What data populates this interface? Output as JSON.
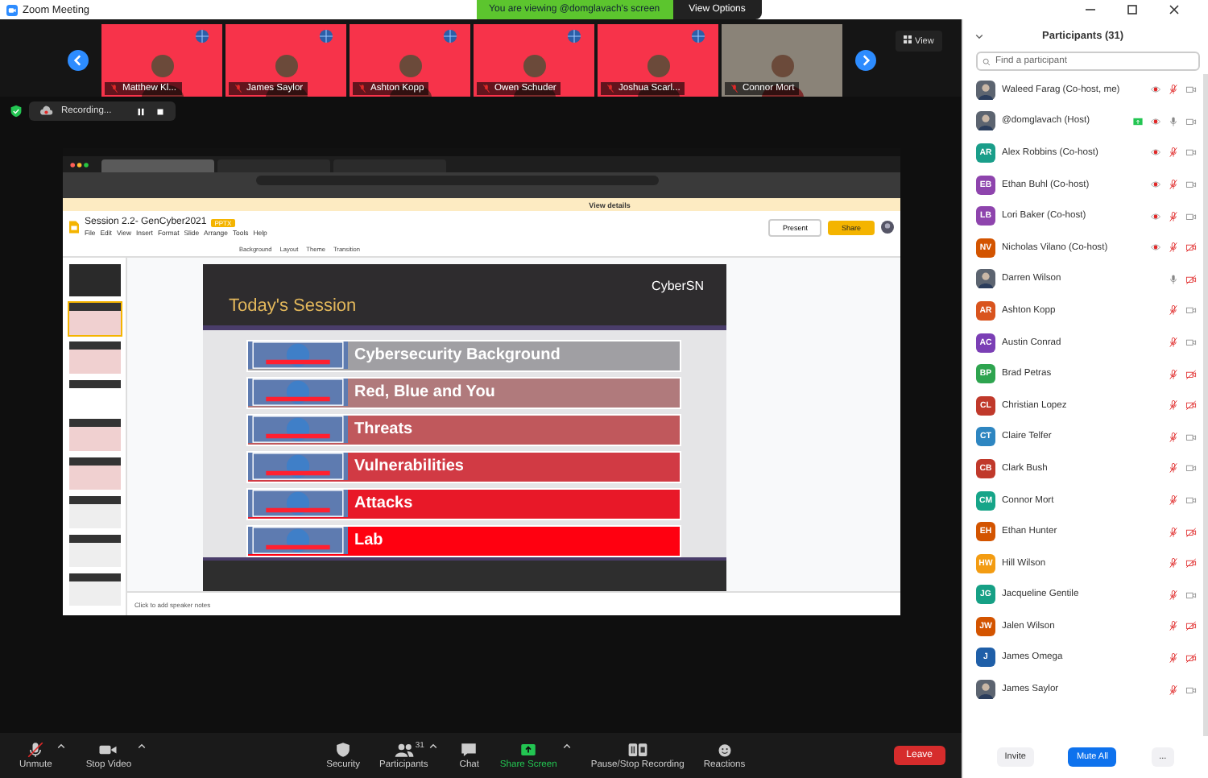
{
  "window": {
    "title": "Zoom Meeting"
  },
  "viewing_banner": {
    "text": "You are viewing @domglavach's screen",
    "options": "View Options"
  },
  "video_strip": {
    "view_label": "View",
    "tiles": [
      {
        "name": "Matthew Kl...",
        "kind": "branded",
        "muted": true
      },
      {
        "name": "James Saylor",
        "kind": "branded",
        "muted": true
      },
      {
        "name": "Ashton Kopp",
        "kind": "branded",
        "muted": true
      },
      {
        "name": "Owen Schuder",
        "kind": "branded",
        "muted": true
      },
      {
        "name": "Joshua Scarl...",
        "kind": "branded",
        "muted": true
      },
      {
        "name": "Connor Mort",
        "kind": "camera",
        "muted": true
      }
    ]
  },
  "recording": {
    "label": "Recording..."
  },
  "shared_screen": {
    "browser_tabs": [
      {
        "selected": true
      },
      {
        "selected": false
      },
      {
        "selected": false
      }
    ],
    "banner_link": "View details",
    "doc_title": "Session 2.2- GenCyber2021",
    "doc_badge": "PPTX",
    "menu": [
      "File",
      "Edit",
      "View",
      "Insert",
      "Format",
      "Slide",
      "Arrange",
      "Tools",
      "Help"
    ],
    "present": "Present",
    "share": "Share",
    "toolbar": [
      "Background",
      "Layout",
      "Theme",
      "Transition"
    ],
    "thumbnails": [
      {
        "kind": "dark",
        "selected": false
      },
      {
        "kind": "list",
        "selected": true
      },
      {
        "kind": "list",
        "selected": false
      },
      {
        "kind": "photo",
        "selected": false
      },
      {
        "kind": "list",
        "selected": false
      },
      {
        "kind": "list",
        "selected": false
      },
      {
        "kind": "grid",
        "selected": false
      },
      {
        "kind": "grid",
        "selected": false
      },
      {
        "kind": "grid",
        "selected": false
      }
    ],
    "slide": {
      "title": "Today's Session",
      "brand": "CyberSN",
      "items": [
        {
          "label": "Cybersecurity Background",
          "color": "#a09fa3"
        },
        {
          "label": "Red, Blue and You",
          "color": "#b07a7c"
        },
        {
          "label": "Threats",
          "color": "#c0585c"
        },
        {
          "label": "Vulnerabilities",
          "color": "#d13a44"
        },
        {
          "label": "Attacks",
          "color": "#e81828"
        },
        {
          "label": "Lab",
          "color": "#ff0010"
        }
      ]
    },
    "notes": "Click to add speaker notes"
  },
  "toolbar": [
    {
      "kind": "mic",
      "label": "Unmute",
      "caret": true
    },
    {
      "kind": "video",
      "label": "Stop Video",
      "caret": true
    },
    {
      "kind": "security",
      "label": "Security",
      "caret": false
    },
    {
      "kind": "participants",
      "label": "Participants",
      "count": "31",
      "caret": true
    },
    {
      "kind": "chat",
      "label": "Chat",
      "caret": false
    },
    {
      "kind": "share",
      "label": "Share Screen",
      "caret": true
    },
    {
      "kind": "record",
      "label": "Pause/Stop Recording",
      "caret": false
    },
    {
      "kind": "reactions",
      "label": "Reactions",
      "caret": false
    }
  ],
  "leave_button": "Leave",
  "participants": {
    "title": "Participants (31)",
    "search": {
      "placeholder": "Find a participant"
    },
    "items": [
      {
        "name": "Waleed Farag (Co-host, me)",
        "kind": "photo",
        "sharing": false,
        "recording": true,
        "muted": true,
        "video_off": false
      },
      {
        "name": "@domglavach (Host)",
        "kind": "photo",
        "sharing": true,
        "recording": true,
        "muted": false,
        "video_off": false
      },
      {
        "name": "Alex Robbins (Co-host)",
        "kind": "initials",
        "initials": "AR",
        "color": "#1a9e8a",
        "sharing": false,
        "recording": true,
        "muted": true,
        "video_off": false
      },
      {
        "name": "Ethan Buhl (Co-host)",
        "kind": "initials",
        "initials": "EB",
        "color": "#8e44ad",
        "sharing": false,
        "recording": true,
        "muted": true,
        "video_off": false
      },
      {
        "name": "Lori Baker (Co-host)",
        "kind": "initials",
        "initials": "LB",
        "color": "#8e44ad",
        "sharing": false,
        "recording": true,
        "muted": true,
        "video_off": false
      },
      {
        "name": "Nicholas Vilano (Co-host)",
        "kind": "initials",
        "initials": "NV",
        "color": "#d35400",
        "sharing": false,
        "recording": true,
        "muted": true,
        "video_off": true
      },
      {
        "name": "Darren Wilson",
        "kind": "photo",
        "sharing": false,
        "recording": false,
        "muted": false,
        "video_off": true
      },
      {
        "name": "Ashton Kopp",
        "kind": "initials",
        "initials": "AR",
        "color": "#d9541e",
        "sharing": false,
        "recording": false,
        "muted": true,
        "video_off": false
      },
      {
        "name": "Austin Conrad",
        "kind": "initials",
        "initials": "AC",
        "color": "#7b3fb5",
        "sharing": false,
        "recording": false,
        "muted": true,
        "video_off": false
      },
      {
        "name": "Brad Petras",
        "kind": "initials",
        "initials": "BP",
        "color": "#2ea44f",
        "sharing": false,
        "recording": false,
        "muted": true,
        "video_off": true
      },
      {
        "name": "Christian Lopez",
        "kind": "initials",
        "initials": "CL",
        "color": "#c0392b",
        "sharing": false,
        "recording": false,
        "muted": true,
        "video_off": true
      },
      {
        "name": "Claire Telfer",
        "kind": "initials",
        "initials": "CT",
        "color": "#2e86c1",
        "sharing": false,
        "recording": false,
        "muted": true,
        "video_off": false
      },
      {
        "name": "Clark Bush",
        "kind": "initials",
        "initials": "CB",
        "color": "#c0392b",
        "sharing": false,
        "recording": false,
        "muted": true,
        "video_off": false
      },
      {
        "name": "Connor Mort",
        "kind": "initials",
        "initials": "CM",
        "color": "#17a589",
        "sharing": false,
        "recording": false,
        "muted": true,
        "video_off": false
      },
      {
        "name": "Ethan Hunter",
        "kind": "initials",
        "initials": "EH",
        "color": "#d35400",
        "sharing": false,
        "recording": false,
        "muted": true,
        "video_off": true
      },
      {
        "name": "Hill Wilson",
        "kind": "initials",
        "initials": "HW",
        "color": "#f39c12",
        "sharing": false,
        "recording": false,
        "muted": true,
        "video_off": true
      },
      {
        "name": "Jacqueline Gentile",
        "kind": "initials",
        "initials": "JG",
        "color": "#16a085",
        "sharing": false,
        "recording": false,
        "muted": true,
        "video_off": false
      },
      {
        "name": "Jalen Wilson",
        "kind": "initials",
        "initials": "JW",
        "color": "#d35400",
        "sharing": false,
        "recording": false,
        "muted": true,
        "video_off": true
      },
      {
        "name": "James Omega",
        "kind": "initials",
        "initials": "J",
        "color": "#1f5fa8",
        "sharing": false,
        "recording": false,
        "muted": true,
        "video_off": true
      },
      {
        "name": "James Saylor",
        "kind": "photo",
        "sharing": false,
        "recording": false,
        "muted": true,
        "video_off": false
      }
    ],
    "buttons": [
      {
        "kind": "plain",
        "label": "Invite"
      },
      {
        "kind": "primary",
        "label": "Mute All"
      },
      {
        "kind": "plain",
        "label": "..."
      }
    ]
  }
}
